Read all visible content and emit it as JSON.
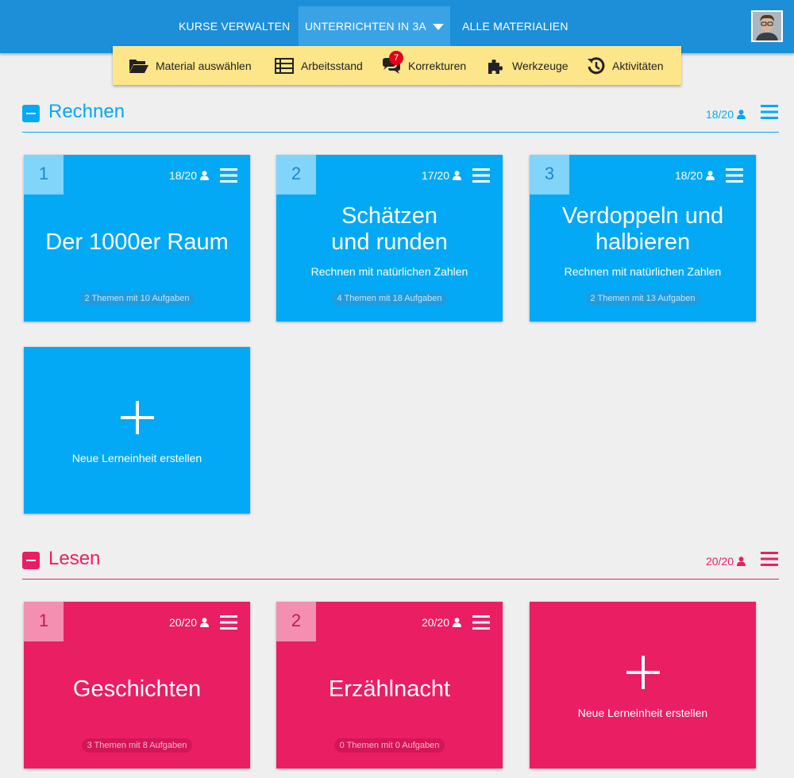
{
  "nav": {
    "items": [
      "KURSE VERWALTEN",
      "UNTERRICHTEN IN 3A",
      "ALLE MATERIALIEN"
    ]
  },
  "toolbar": {
    "items": [
      {
        "label": "Material auswählen",
        "icon": "folder-open-icon"
      },
      {
        "label": "Arbeitsstand",
        "icon": "list-table-icon"
      },
      {
        "label": "Korrekturen",
        "icon": "comments-icon",
        "badge": "7"
      },
      {
        "label": "Werkzeuge",
        "icon": "puzzle-icon"
      },
      {
        "label": "Aktivitäten",
        "icon": "history-icon"
      }
    ]
  },
  "colors": {
    "nav": "#1d8fd8",
    "toolbar": "#fde58a",
    "rechnen": "#03a9f4",
    "lesen": "#e91e63",
    "badge": "#e2001a"
  },
  "sections": [
    {
      "title": "Rechnen",
      "count": "18/20",
      "cards": [
        {
          "num": "1",
          "count": "18/20",
          "title": "Der 1000er Raum",
          "subtitle": "",
          "pill": "2 Themen mit 10 Aufgaben"
        },
        {
          "num": "2",
          "count": "17/20",
          "title": "Schätzen und runden",
          "subtitle": "Rechnen mit natürlichen Zahlen",
          "pill": "4 Themen mit 18 Aufgaben"
        },
        {
          "num": "3",
          "count": "18/20",
          "title": "Verdoppeln und halbieren",
          "subtitle": "Rechnen mit natürlichen Zahlen",
          "pill": "2 Themen mit 13 Aufgaben"
        }
      ],
      "new_label": "Neue Lerneinheit erstellen"
    },
    {
      "title": "Lesen",
      "count": "20/20",
      "cards": [
        {
          "num": "1",
          "count": "20/20",
          "title": "Geschichten",
          "subtitle": "",
          "pill": "3 Themen mit 8 Aufgaben"
        },
        {
          "num": "2",
          "count": "20/20",
          "title": "Erzählnacht",
          "subtitle": "",
          "pill": "0 Themen mit 0 Aufgaben"
        }
      ],
      "new_label": "Neue Lerneinheit erstellen"
    }
  ]
}
